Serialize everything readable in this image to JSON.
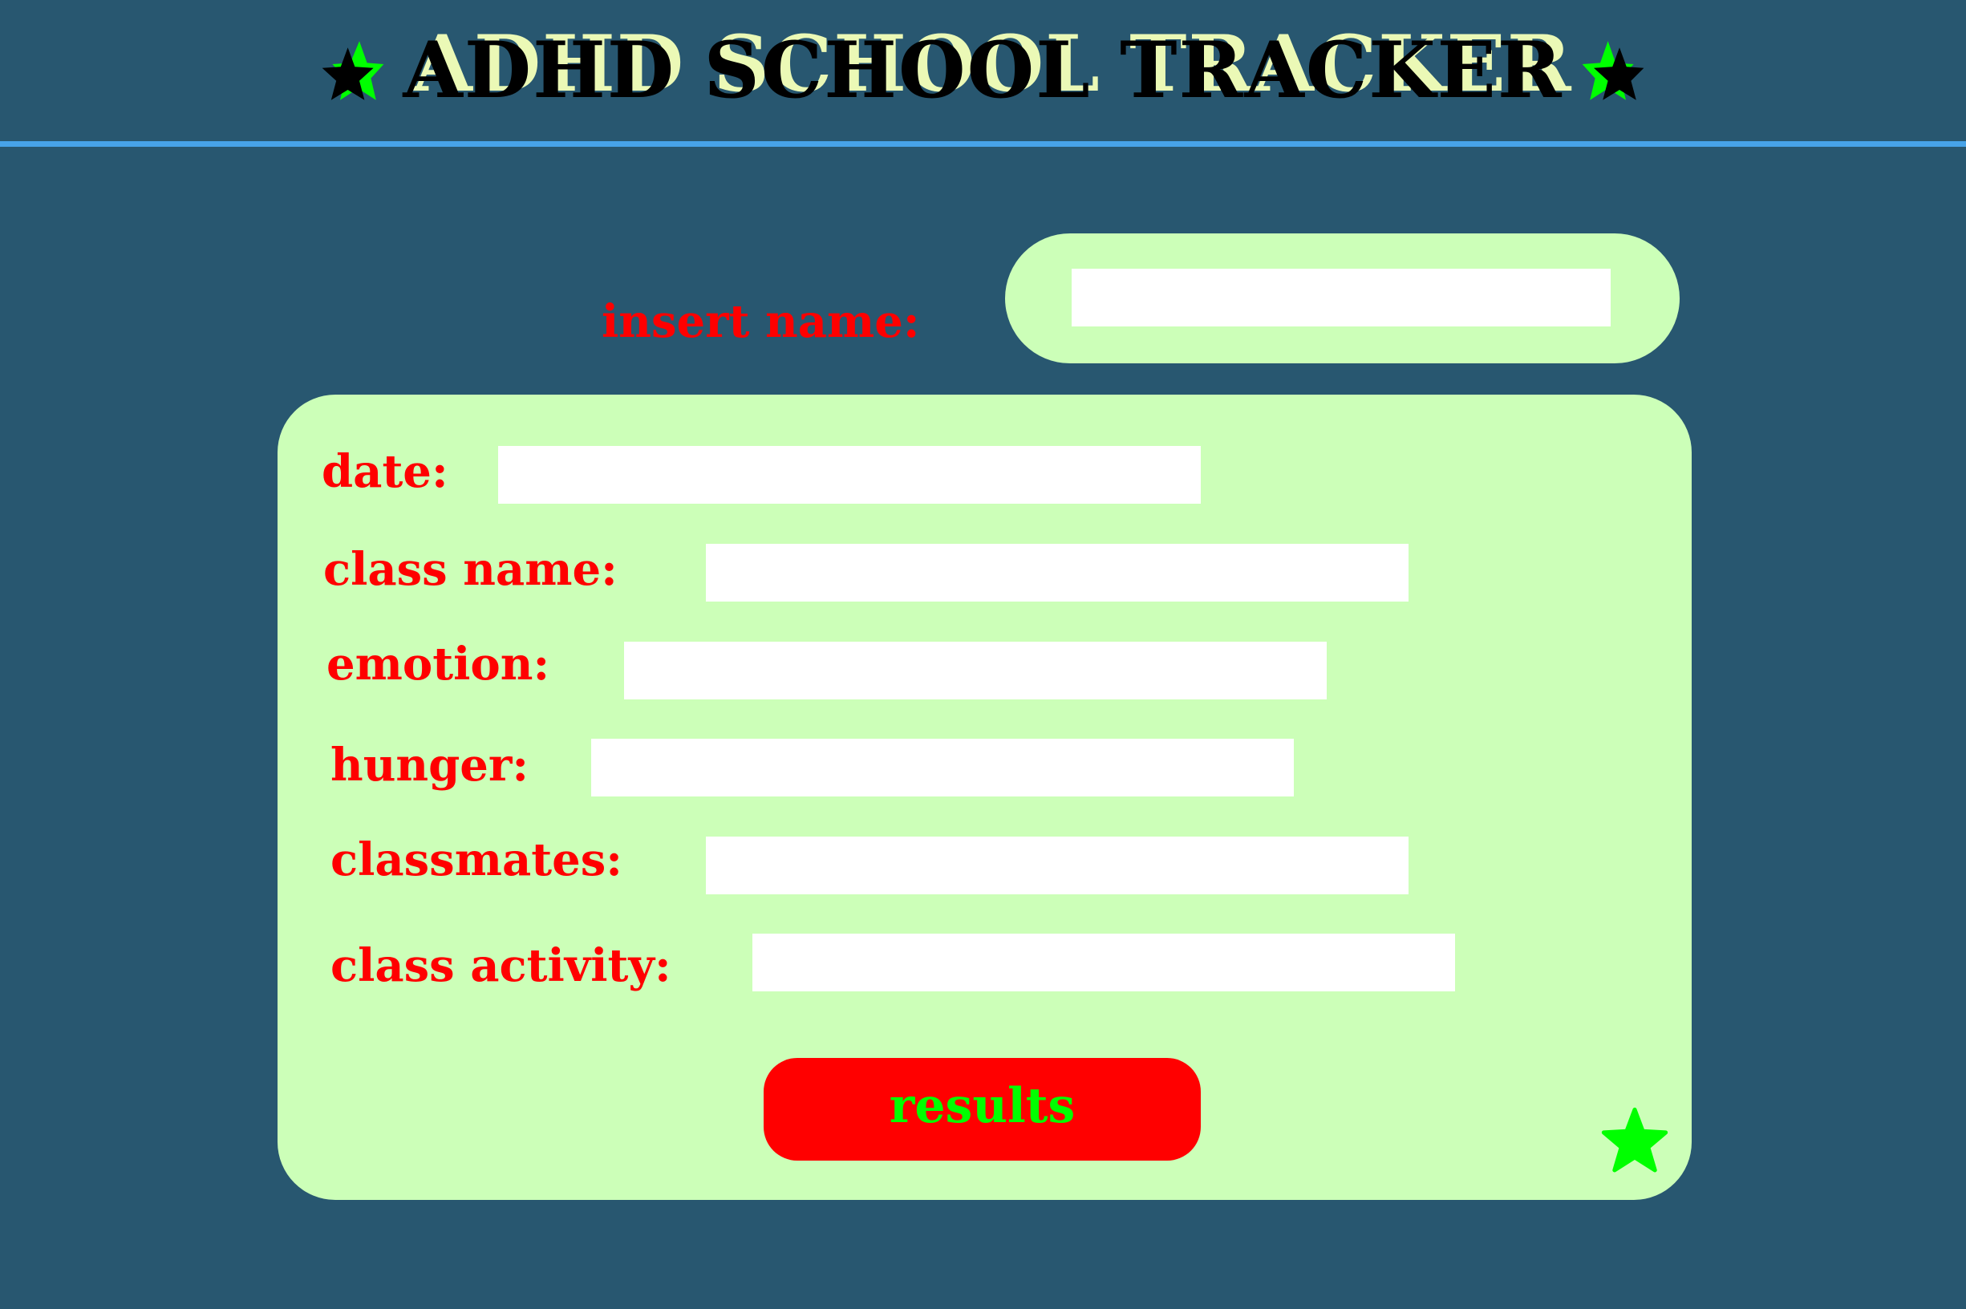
{
  "header": {
    "title": "ADHD SCHOOL TRACKER",
    "star_icon": "star-icon"
  },
  "name_section": {
    "label": "insert name:",
    "value": "",
    "placeholder": ""
  },
  "form": {
    "fields": [
      {
        "label": "date:",
        "value": ""
      },
      {
        "label": "class name:",
        "value": ""
      },
      {
        "label": "emotion:",
        "value": ""
      },
      {
        "label": "hunger:",
        "value": ""
      },
      {
        "label": "classmates:",
        "value": ""
      },
      {
        "label": "class activity:",
        "value": ""
      }
    ],
    "submit_label": "results"
  },
  "colors": {
    "background": "#285770",
    "divider": "#47a3e8",
    "panel": "#ccffb8",
    "label_text": "#ff0000",
    "button": "#ff0000",
    "button_text": "#00ff00",
    "star_fill": "#00ff00",
    "title_shadow": "#ebf9b6"
  }
}
